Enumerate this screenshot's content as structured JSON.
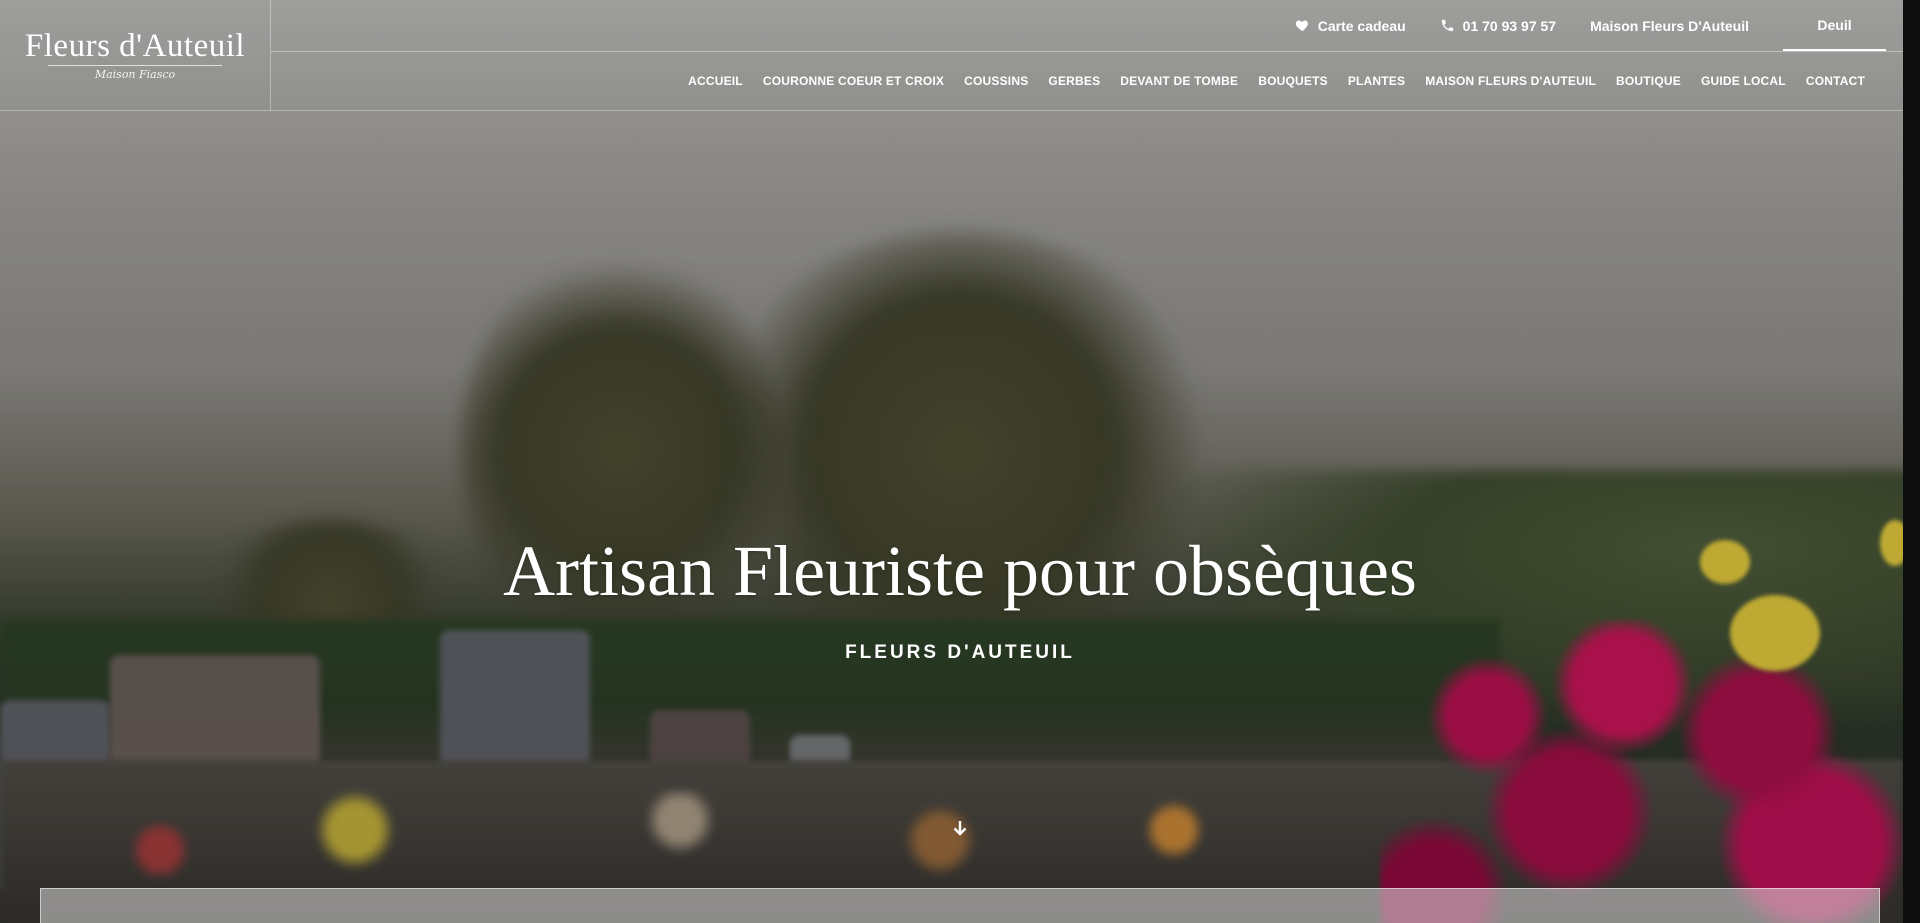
{
  "logo": {
    "main": "Fleurs d'Auteuil",
    "sub": "Maison Fiasco"
  },
  "topbar": {
    "gift": {
      "label": "Carte cadeau",
      "icon": "heart-icon"
    },
    "phone": {
      "label": "01 70 93 97 57",
      "icon": "phone-icon"
    },
    "tabs": [
      {
        "label": "Maison Fleurs D'Auteuil",
        "active": false
      },
      {
        "label": "Deuil",
        "active": true
      }
    ]
  },
  "nav": {
    "items": [
      "ACCUEIL",
      "COURONNE COEUR ET CROIX",
      "COUSSINS",
      "GERBES",
      "DEVANT DE TOMBE",
      "BOUQUETS",
      "PLANTES",
      "MAISON FLEURS D'AUTEUIL",
      "BOUTIQUE",
      "GUIDE LOCAL",
      "CONTACT"
    ]
  },
  "hero": {
    "title": "Artisan Fleuriste pour obsèques",
    "subtitle": "FLEURS D'AUTEUIL",
    "scroll_icon": "arrow-down-icon"
  },
  "colors": {
    "text": "#ffffff",
    "flowers": "#b0114e"
  }
}
